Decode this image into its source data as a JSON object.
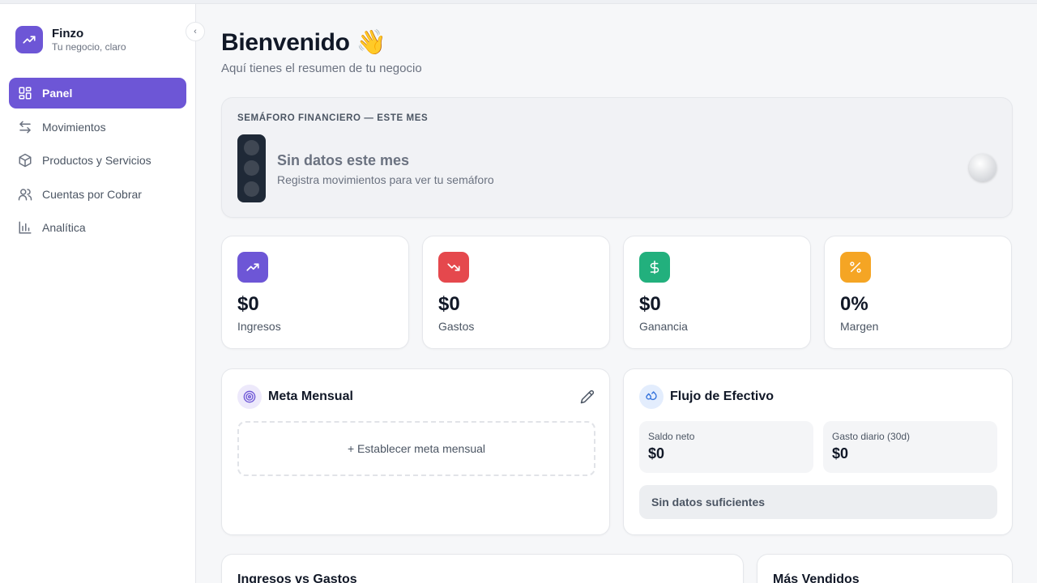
{
  "brand": {
    "name": "Finzo",
    "tagline": "Tu negocio, claro",
    "icon": "trending-up-icon",
    "color": "#6d56d6"
  },
  "sidebar": {
    "collapse_glyph": "‹",
    "items": [
      {
        "label": "Panel",
        "icon": "dashboard-icon",
        "active": true
      },
      {
        "label": "Movimientos",
        "icon": "arrows-left-right-icon",
        "active": false
      },
      {
        "label": "Productos y Servicios",
        "icon": "package-icon",
        "active": false
      },
      {
        "label": "Cuentas por Cobrar",
        "icon": "users-icon",
        "active": false
      },
      {
        "label": "Analítica",
        "icon": "bar-chart-icon",
        "active": false
      }
    ]
  },
  "header": {
    "title": "Bienvenido 👋",
    "subtitle": "Aquí tienes el resumen de tu negocio"
  },
  "semaforo": {
    "label": "SEMÁFORO FINANCIERO — ESTE MES",
    "title": "Sin datos este mes",
    "description": "Registra movimientos para ver tu semáforo"
  },
  "stats": [
    {
      "value": "$0",
      "label": "Ingresos",
      "icon": "trending-up-icon",
      "color": "#6d56d6"
    },
    {
      "value": "$0",
      "label": "Gastos",
      "icon": "trending-down-icon",
      "color": "#e5484d"
    },
    {
      "value": "$0",
      "label": "Ganancia",
      "icon": "dollar-icon",
      "color": "#22b07d"
    },
    {
      "value": "0%",
      "label": "Margen",
      "icon": "percent-icon",
      "color": "#f5a524"
    }
  ],
  "meta": {
    "title": "Meta Mensual",
    "action": "+ Establecer meta mensual"
  },
  "flujo": {
    "title": "Flujo de Efectivo",
    "saldo_label": "Saldo neto",
    "saldo_value": "$0",
    "gasto_label": "Gasto diario (30d)",
    "gasto_value": "$0",
    "empty": "Sin datos suficientes"
  },
  "bottom": {
    "left_title": "Ingresos vs Gastos",
    "right_title": "Más Vendidos"
  }
}
